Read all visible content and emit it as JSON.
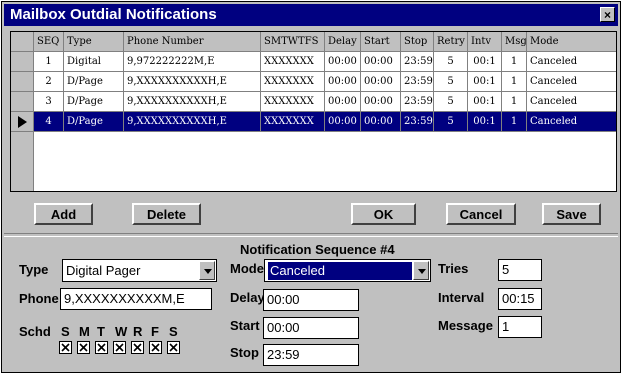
{
  "window": {
    "title": "Mailbox Outdial Notifications",
    "close_label": "×"
  },
  "grid": {
    "columns": [
      "SEQ",
      "Type",
      "Phone Number",
      "SMTWTFS",
      "Delay",
      "Start",
      "Stop",
      "Retry",
      "Intv",
      "Msg",
      "Mode"
    ],
    "rows": [
      [
        "1",
        "Digital",
        "9,972222222M,E",
        "XXXXXXX",
        "00:00",
        "00:00",
        "23:59",
        "5",
        "00:1",
        "1",
        "Canceled"
      ],
      [
        "2",
        "D/Page",
        "9,XXXXXXXXXXH,E",
        "XXXXXXX",
        "00:00",
        "00:00",
        "23:59",
        "5",
        "00:1",
        "1",
        "Canceled"
      ],
      [
        "3",
        "D/Page",
        "9,XXXXXXXXXXH,E",
        "XXXXXXX",
        "00:00",
        "00:00",
        "23:59",
        "5",
        "00:1",
        "1",
        "Canceled"
      ],
      [
        "4",
        "D/Page",
        "9,XXXXXXXXXXH,E",
        "XXXXXXX",
        "00:00",
        "00:00",
        "23:59",
        "5",
        "00:1",
        "1",
        "Canceled"
      ]
    ],
    "selected_row": 3
  },
  "buttons": {
    "add": "Add",
    "delete": "Delete",
    "ok": "OK",
    "cancel": "Cancel",
    "save": "Save"
  },
  "form": {
    "section_title": "Notification Sequence #4",
    "type_label": "Type",
    "type_value": "Digital Pager",
    "phone_label": "Phone",
    "phone_value": "9,XXXXXXXXXXM,E",
    "schd_label": "Schd",
    "days": [
      "S",
      "M",
      "T",
      "W",
      "R",
      "F",
      "S"
    ],
    "days_checked": [
      true,
      true,
      true,
      true,
      true,
      true,
      true
    ],
    "mode_label": "Mode",
    "mode_value": "Canceled",
    "delay_label": "Delay",
    "delay_value": "00:00",
    "start_label": "Start",
    "start_value": "00:00",
    "stop_label": "Stop",
    "stop_value": "23:59",
    "tries_label": "Tries",
    "tries_value": "5",
    "interval_label": "Interval",
    "interval_value": "00:15",
    "message_label": "Message",
    "message_value": "1"
  },
  "icons": {
    "row_pointer": "row-pointer-icon",
    "checkmark": "x-check-icon",
    "dropdown": "chevron-down-icon"
  }
}
